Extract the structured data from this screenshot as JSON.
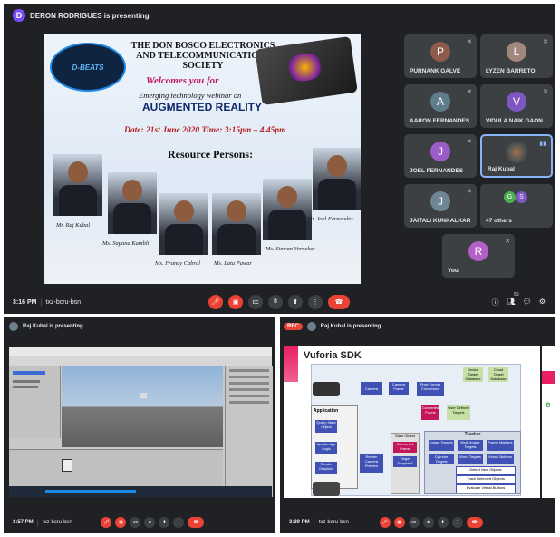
{
  "main": {
    "presenter_initial": "D",
    "presenting_text": "DERON RODRIGUES is presenting",
    "slide": {
      "logo_text": "D-BEATS",
      "society_line1": "THE DON BOSCO ELECTRONICS",
      "society_line2": "AND TELECOMMUNICATIONS",
      "society_line3": "SOCIETY",
      "welcome": "Welcomes you for",
      "subtitle": "Emerging technology webinar on",
      "topic": "AUGMENTED REALITY",
      "date_line": "Date: 21st June 2020  Time: 3:15pm – 4.45pm",
      "resource_heading": "Resource Persons:",
      "persons": [
        "Mr. Raj Kubal",
        "Ms. Sapana Kambli",
        "Ms. Francy Cabral",
        "Ms. Lata Pawar",
        "Ms. Simran Vernekar",
        "Mr. Joel Fernandes"
      ]
    },
    "participants": [
      {
        "initial": "P",
        "name": "PURNANK GALVE",
        "color": "#8e5a4a"
      },
      {
        "initial": "L",
        "name": "LYZEN BARRETO",
        "color": "#a1887f"
      },
      {
        "initial": "A",
        "name": "AARON FERNANDES",
        "color": "#5f7c8a"
      },
      {
        "initial": "V",
        "name": "VIDULA NAIK GAON...",
        "color": "#7e57c2"
      },
      {
        "initial": "J",
        "name": "JOEL FERNANDES",
        "color": "#9c5cc8"
      },
      {
        "initial": "",
        "name": "Raj Kubal",
        "color": "#6d7f8c"
      },
      {
        "initial": "J",
        "name": "JAITALI KUNKALKAR",
        "color": "#6f8694"
      },
      {
        "initial": "G S",
        "name": "47 others",
        "color": "#3c4043"
      },
      {
        "initial": "R",
        "name": "You",
        "color": "#b560c8"
      }
    ],
    "time": "3:16 PM",
    "meeting_code": "txz-bcru-bsn",
    "people_count": "56"
  },
  "left": {
    "presenting_text": "Raj Kubal is presenting",
    "time": "3:57 PM",
    "meeting_code": "txz-bcru-bsn"
  },
  "right": {
    "rec_label": "REC",
    "presenting_text": "Raj Kubal is presenting",
    "slide_title": "Vuforia SDK",
    "blocks": {
      "camera": "Camera",
      "camera_frame": "Camera Frame",
      "pixel_format": "Pixel Format Conversion",
      "application": "Application",
      "query_state": "Query State Object",
      "update_logic": "Update App Logic",
      "render_graphics": "Render Graphics",
      "render_preview": "Render Camera Preview",
      "converted_frame": "Converted Frame",
      "state_object": "State Object",
      "target_snapshot": "Target Snapshot",
      "user_targets": "User Defined Targets",
      "tracker": "Tracker",
      "image_targets": "Image Targets",
      "multi_targets": "Multi-Image Targets",
      "frame_markers": "Frame Markers",
      "cylinder_targets": "Cylinder Targets",
      "word_targets": "Word Targets",
      "virtual_buttons": "Virtual Buttons",
      "detect": "Detect New Objects",
      "track": "Track Detected Objects",
      "evaluate": "Evaluate Virtual Buttons",
      "device_db": "Device Target Database",
      "cloud_db": "Cloud Target Database"
    },
    "time": "3:39 PM",
    "meeting_code": "txz-bcru-bsn"
  }
}
